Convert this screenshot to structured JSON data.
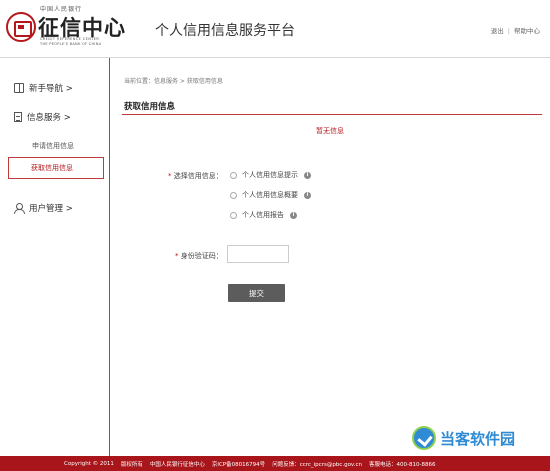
{
  "header": {
    "logo_top": "中国人民银行",
    "logo_name": "征信中心",
    "logo_en_line1": "CREDIT REFERENCE CENTER",
    "logo_en_line2": "THE PEOPLE'S BANK OF CHINA",
    "platform_title": "个人信用信息服务平台",
    "logout_label": "退出",
    "separator": "|",
    "help_label": "帮助中心"
  },
  "sidebar": {
    "items": [
      {
        "label": "新手导航 >",
        "icon": "book-icon"
      },
      {
        "label": "信息服务 >",
        "icon": "document-icon"
      },
      {
        "label": "用户管理 >",
        "icon": "user-icon"
      }
    ],
    "sub_items": [
      {
        "label": "申请信用信息"
      },
      {
        "label": "获取信用信息"
      }
    ]
  },
  "main": {
    "breadcrumb": "当前位置：信息服务 > 获取信用信息",
    "section_title": "获取信用信息",
    "no_info": "暂无信息",
    "select_label_req": "*",
    "select_label": "选择信用信息：",
    "options": [
      {
        "label": "个人信用信息提示"
      },
      {
        "label": "个人信用信息概要"
      },
      {
        "label": "个人信用报告"
      }
    ],
    "code_label_req": "*",
    "code_label": "身份验证码：",
    "code_value": "",
    "submit_label": "提交",
    "info_icon_glyph": "i"
  },
  "footer": {
    "copyright": "Copyright © 2011",
    "rights": "版权所有",
    "org": "中国人民银行征信中心",
    "icp": "京ICP备08016794号",
    "feedback": "问题反馈：ccrc_ipcrs@pbc.gov.cn",
    "hotline": "客服电话：400-810-8866"
  },
  "watermark": {
    "text": "当客软件园"
  },
  "colors": {
    "accent": "#b5171d",
    "footer_bg": "#a8151b",
    "button_bg": "#5c5c5c"
  }
}
